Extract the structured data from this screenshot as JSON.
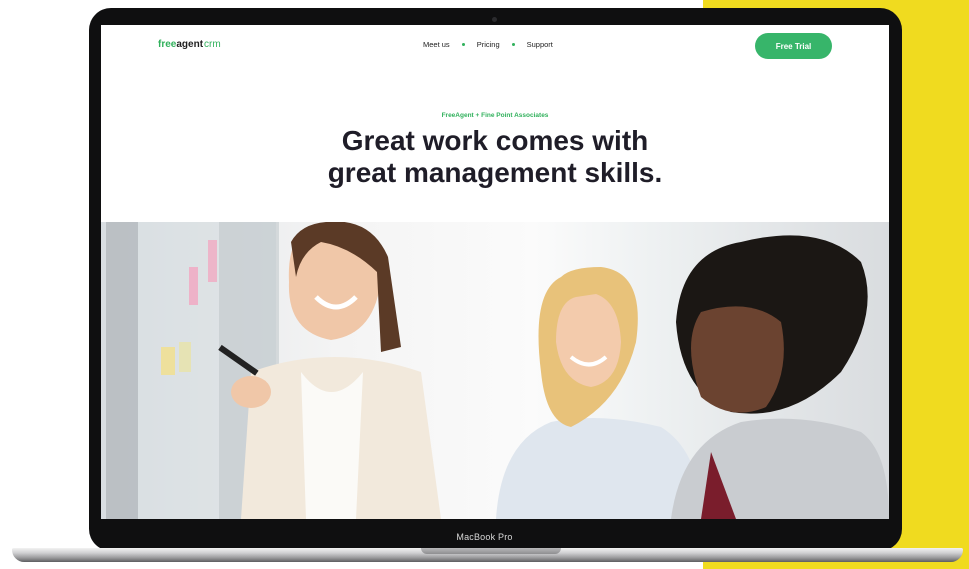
{
  "device": {
    "label": "MacBook Pro"
  },
  "site": {
    "logo": {
      "part1": "free",
      "part2": "agent",
      "part3": "crm"
    },
    "nav": [
      {
        "label": "Meet us"
      },
      {
        "label": "Pricing"
      },
      {
        "label": "Support"
      }
    ],
    "cta": {
      "label": "Free Trial"
    }
  },
  "hero": {
    "eyebrow": "FreeAgent + Fine Point Associates",
    "headline_line1": "Great work comes with",
    "headline_line2": "great management skills.",
    "image": "team-meeting-photo"
  },
  "colors": {
    "accent_green": "#37b56a",
    "accent_yellow": "#f0db1f",
    "headline": "#1f1d28"
  }
}
